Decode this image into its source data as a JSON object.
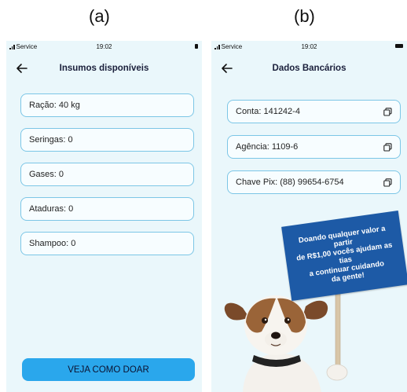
{
  "labels": {
    "a": "(a)",
    "b": "(b)"
  },
  "status": {
    "carrier": "Service",
    "time": "19:02"
  },
  "screen_a": {
    "title": "Insumos disponíveis",
    "items": [
      "Ração: 40 kg",
      "Seringas: 0",
      "Gases: 0",
      "Ataduras: 0",
      "Shampoo: 0"
    ],
    "cta": "VEJA COMO DOAR"
  },
  "screen_b": {
    "title": "Dados Bancários",
    "items": [
      "Conta: 141242-4",
      "Agência: 1109-6",
      "Chave Pix: (88) 99654-6754"
    ],
    "sign_lines": [
      "Doando qualquer valor a partir",
      "de R$1,00 vocês ajudam as tias",
      "a continuar cuidando",
      "da gente!"
    ]
  },
  "colors": {
    "accent": "#2aa7ec",
    "field_border": "#7cc6e6",
    "background": "#eaf7fb",
    "sign": "#1d5aa6"
  },
  "icons": [
    "back-arrow-icon",
    "copy-icon",
    "signal-icon",
    "battery-icon"
  ]
}
